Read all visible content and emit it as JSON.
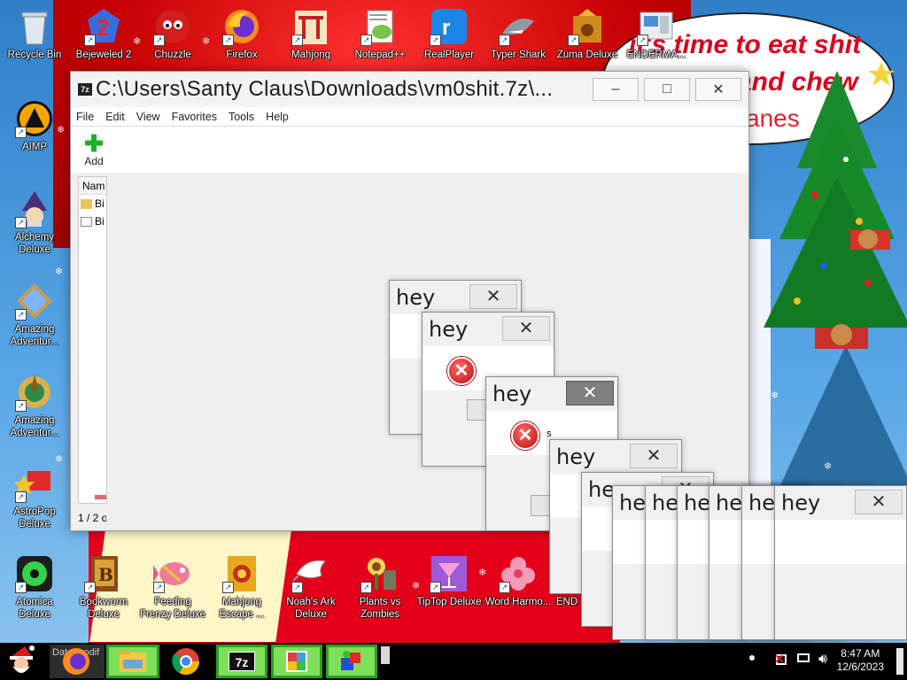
{
  "desktop": {
    "top_row": [
      {
        "label": "Recycle Bin",
        "icon": "recycle-bin-icon"
      },
      {
        "label": "Bejeweled 2",
        "icon": "bejeweled-icon"
      },
      {
        "label": "Chuzzle",
        "icon": "chuzzle-icon"
      },
      {
        "label": "Firefox",
        "icon": "firefox-icon"
      },
      {
        "label": "Mahjong",
        "icon": "mahjong-icon"
      },
      {
        "label": "Notepad++",
        "icon": "notepadpp-icon"
      },
      {
        "label": "RealPlayer",
        "icon": "realplayer-icon"
      },
      {
        "label": "Typer Shark",
        "icon": "typer-shark-icon"
      },
      {
        "label": "Zuma Deluxe",
        "icon": "zuma-icon"
      },
      {
        "label": "ENDERMA...",
        "icon": "enderman-icon"
      }
    ],
    "left_col": [
      {
        "label": "AIMP",
        "icon": "aimp-icon"
      },
      {
        "label": "Alchemy Deluxe",
        "icon": "alchemy-icon"
      },
      {
        "label": "Amazing Adventur...",
        "icon": "amazing-adventures-icon"
      },
      {
        "label": "Amazing Adventur...",
        "icon": "amazing-adventures-2-icon"
      },
      {
        "label": "AstroPop Deluxe",
        "icon": "astropop-icon"
      }
    ],
    "bottom_row": [
      {
        "label": "Atomica Deluxe",
        "icon": "atomica-icon"
      },
      {
        "label": "Bookworm Deluxe",
        "icon": "bookworm-icon"
      },
      {
        "label": "Feeding Frenzy Deluxe",
        "icon": "feeding-frenzy-icon"
      },
      {
        "label": "Mahjong Escape ...",
        "icon": "mahjong-escape-icon"
      },
      {
        "label": "Noah's Ark Deluxe",
        "icon": "noahs-ark-icon"
      },
      {
        "label": "Plants vs Zombies",
        "icon": "pvz-icon"
      },
      {
        "label": "TipTop Deluxe",
        "icon": "tiptop-icon"
      },
      {
        "label": "Word Harmo...",
        "icon": "word-harmony-icon"
      },
      {
        "label": "END",
        "icon": "end-icon"
      }
    ]
  },
  "wallpaper": {
    "bubble_lines": [
      "it's time to eat shit",
      "and chew",
      "anes"
    ]
  },
  "zip_window": {
    "title": "C:\\Users\\Santy Claus\\Downloads\\vm0shit.7z\\...",
    "app_icon": "7z",
    "minimize": "–",
    "maximize": "□",
    "close": "✕",
    "menu": [
      "File",
      "Edit",
      "View",
      "Favorites",
      "Tools",
      "Help"
    ],
    "add_label": "Add",
    "column_name": "Nam",
    "rows": [
      {
        "name": "Bi",
        "type": "folder"
      },
      {
        "name": "Bi",
        "type": "file"
      }
    ],
    "status": "1 / 2 o"
  },
  "dialogs": {
    "title": "hey",
    "close": "✕",
    "error_icon": "✕",
    "message_fragment": "s"
  },
  "taskbar": {
    "start_icon": "santa-icon",
    "search_partial": "Date modif",
    "pinned": [
      "firefox-icon",
      "file-explorer-icon",
      "chrome-icon",
      "7zip-icon",
      "control-panel-icon",
      "app-icon"
    ],
    "app_7z": "7z",
    "time": "8:47 AM",
    "date": "12/6/2023"
  }
}
